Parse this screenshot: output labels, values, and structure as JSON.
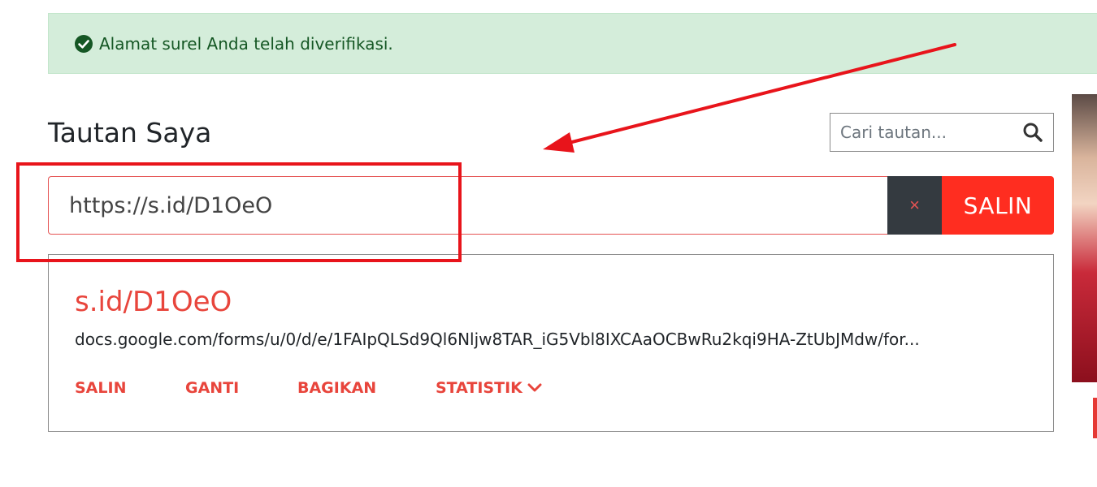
{
  "alert": {
    "message": "Alamat surel Anda telah diverifikasi.",
    "icon": "check-circle-icon",
    "color": "#155724",
    "background": "#d4edda"
  },
  "main": {
    "title": "Tautan Saya",
    "search": {
      "placeholder": "Cari tautan...",
      "value": "",
      "icon": "search-icon"
    },
    "url_input": {
      "value": "https://s.id/D1OeO"
    },
    "clear_button": {
      "label": "×"
    },
    "copy_button": {
      "label": "SALIN"
    },
    "link_card": {
      "short_link": "s.id/D1OeO",
      "long_link": "docs.google.com/forms/u/0/d/e/1FAIpQLSd9Ql6Nljw8TAR_iG5Vbl8IXCAaOCBwRu2kqi9HA-ZtUbJMdw/for...",
      "actions": {
        "copy": "SALIN",
        "change": "GANTI",
        "share": "BAGIKAN",
        "stats": "STATISTIK"
      }
    }
  },
  "colors": {
    "accent": "#ff2d20",
    "link": "#e8453c",
    "annotation": "#e8141b"
  }
}
